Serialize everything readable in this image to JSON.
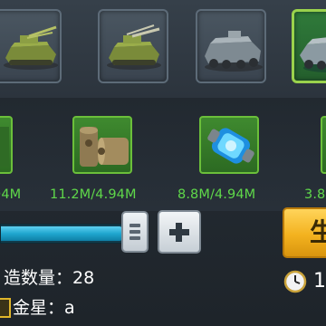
{
  "vehicles": [
    {
      "name": "tank-variant-1-icon",
      "selected": false
    },
    {
      "name": "tank-variant-2-icon",
      "selected": false
    },
    {
      "name": "armored-car-icon",
      "selected": false
    },
    {
      "name": "selected-vehicle-icon",
      "selected": true
    }
  ],
  "resources": [
    {
      "icon": "resource-partial-icon",
      "amount": "94M"
    },
    {
      "icon": "bullets-icon",
      "amount": "11.2M/4.94M"
    },
    {
      "icon": "energy-capsule-icon",
      "amount": "8.8M/4.94M"
    },
    {
      "icon": "resource-partial-icon",
      "amount": "3.8"
    }
  ],
  "production": {
    "slider_fill_fraction": 0.92,
    "count_label": "造数量：28",
    "rank_label": "金星：a",
    "build_label": "生",
    "time_prefix": "1"
  },
  "colors": {
    "resource_text": "#5fd84a",
    "build_button": "#f3b21f",
    "selected_border": "#9ad24c",
    "slider_fill": "#1fa6cf"
  }
}
